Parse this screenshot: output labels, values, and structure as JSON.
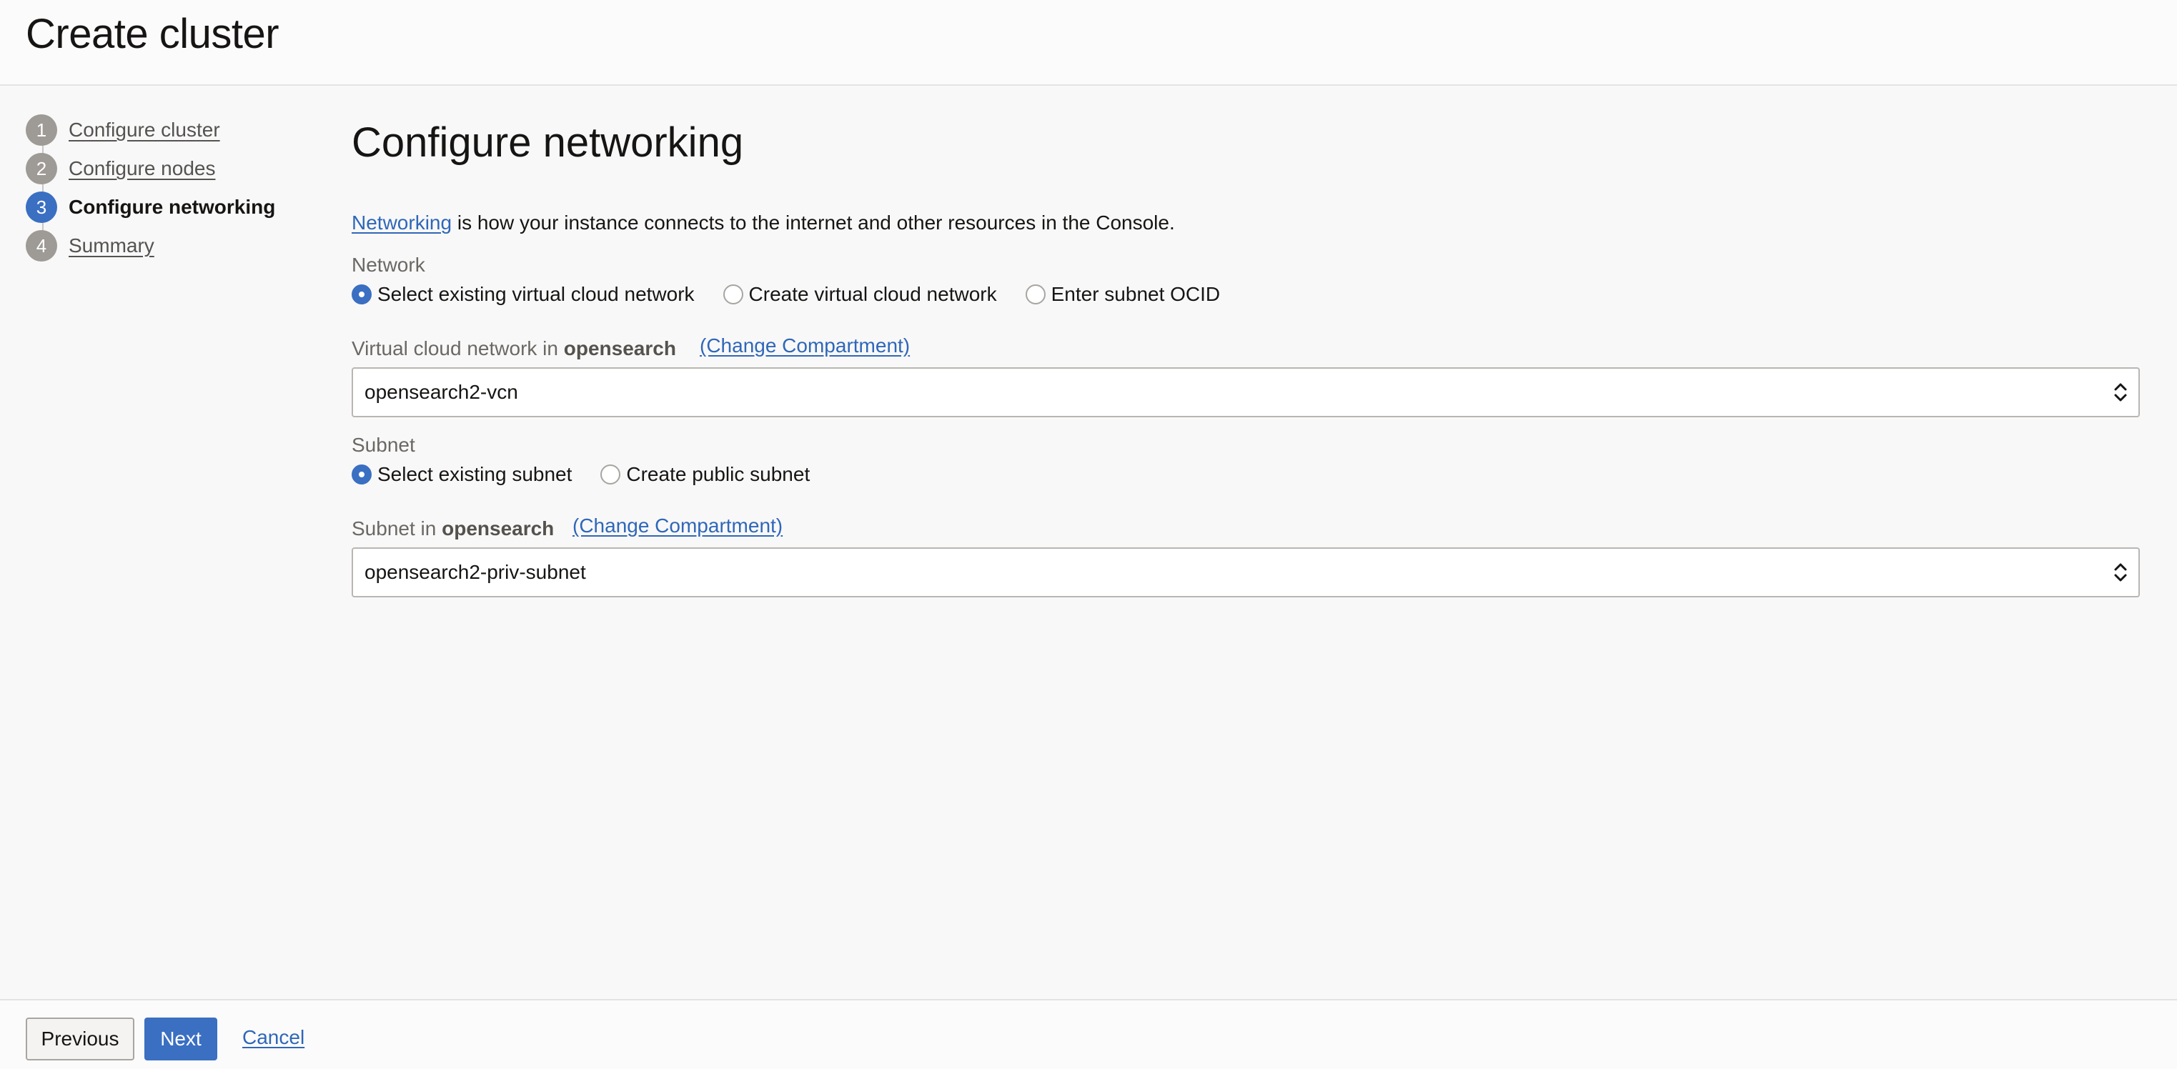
{
  "header": {
    "title": "Create cluster"
  },
  "steps": [
    {
      "number": "1",
      "label": "Configure cluster",
      "active": false
    },
    {
      "number": "2",
      "label": "Configure nodes",
      "active": false
    },
    {
      "number": "3",
      "label": "Configure networking",
      "active": true
    },
    {
      "number": "4",
      "label": "Summary",
      "active": false
    }
  ],
  "main": {
    "title": "Configure networking",
    "intro_link": "Networking",
    "intro_text": " is how your instance connects to the internet and other resources in the Console.",
    "network": {
      "label": "Network",
      "options": [
        {
          "label": "Select existing virtual cloud network",
          "checked": true
        },
        {
          "label": "Create virtual cloud network",
          "checked": false
        },
        {
          "label": "Enter subnet OCID",
          "checked": false
        }
      ]
    },
    "vcn": {
      "label_prefix": "Virtual cloud network in ",
      "compartment": "opensearch",
      "change_link": "(Change Compartment)",
      "selected": "opensearch2-vcn"
    },
    "subnet": {
      "label": "Subnet",
      "options": [
        {
          "label": "Select existing subnet",
          "checked": true
        },
        {
          "label": "Create public subnet",
          "checked": false
        }
      ]
    },
    "subnet_select": {
      "label_prefix": "Subnet in ",
      "compartment": "opensearch",
      "change_link": "(Change Compartment)",
      "selected": "opensearch2-priv-subnet"
    }
  },
  "footer": {
    "previous": "Previous",
    "next": "Next",
    "cancel": "Cancel"
  },
  "colors": {
    "accent": "#3a6fc2",
    "link": "#2f67b8",
    "step_inactive": "#9e9a96"
  }
}
